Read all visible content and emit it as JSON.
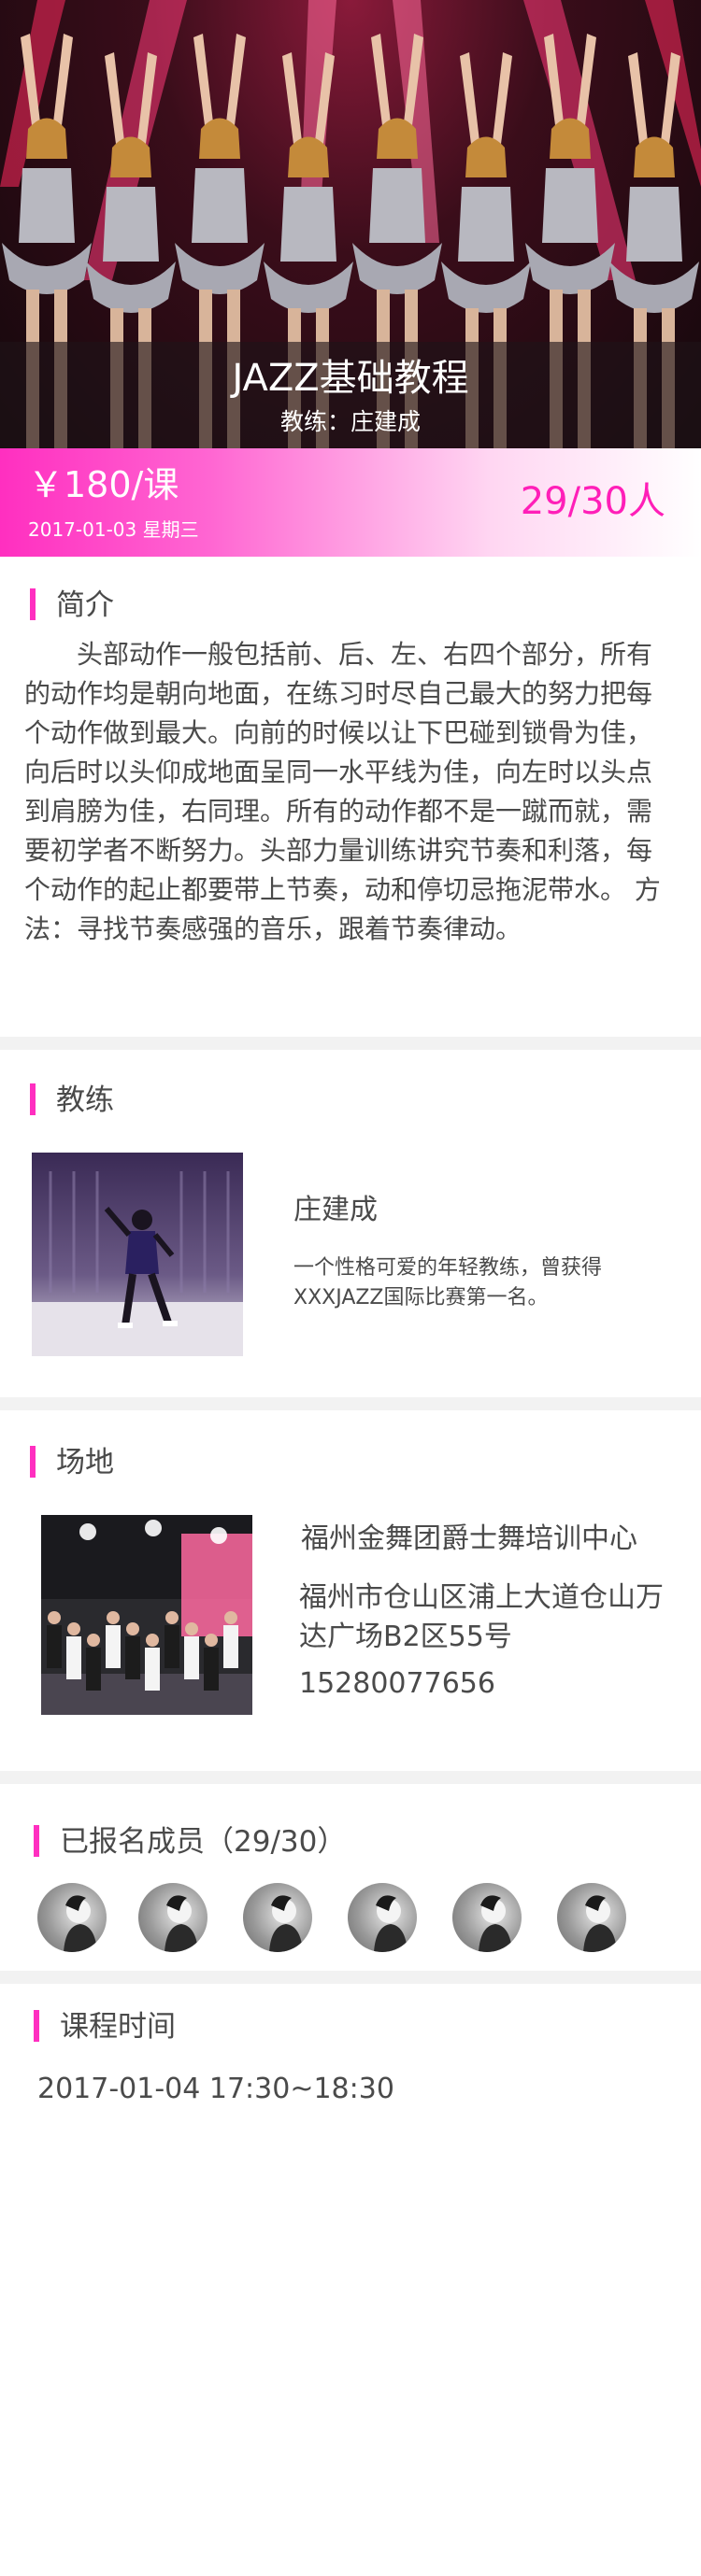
{
  "hero": {
    "title": "JAZZ基础教程",
    "coach_line": "教练：庄建成"
  },
  "price_bar": {
    "price": "￥180/课",
    "date": "2017-01-03 星期三",
    "enrollment": "29/30人"
  },
  "intro": {
    "heading": "简介",
    "text": "头部动作一般包括前、后、左、右四个部分，所有的动作均是朝向地面，在练习时尽自己最大的努力把每个动作做到最大。向前的时候以让下巴碰到锁骨为佳，向后时以头仰成地面呈同一水平线为佳，向左时以头点到肩膀为佳，右同理。所有的动作都不是一蹴而就，需要初学者不断努力。头部力量训练讲究节奏和利落，每个动作的起止都要带上节奏，动和停切忌拖泥带水。 方法：寻找节奏感强的音乐，跟着节奏律动。"
  },
  "coach": {
    "heading": "教练",
    "name": "庄建成",
    "description": "一个性格可爱的年轻教练，曾获得XXXJAZZ国际比赛第一名。"
  },
  "venue": {
    "heading": "场地",
    "name": "福州金舞团爵士舞培训中心",
    "address": "福州市仓山区浦上大道仓山万达广场B2区55号",
    "phone": "15280077656"
  },
  "members": {
    "heading": "已报名成员（29/30）",
    "avatar_count": 6
  },
  "schedule": {
    "heading": "课程时间",
    "time": "2017-01-04 17:30~18:30"
  },
  "colors": {
    "accent": "#ff2fc0",
    "count_text": "#ff1fb8",
    "text": "#4a4a4a",
    "divider": "#f2f2f2"
  }
}
